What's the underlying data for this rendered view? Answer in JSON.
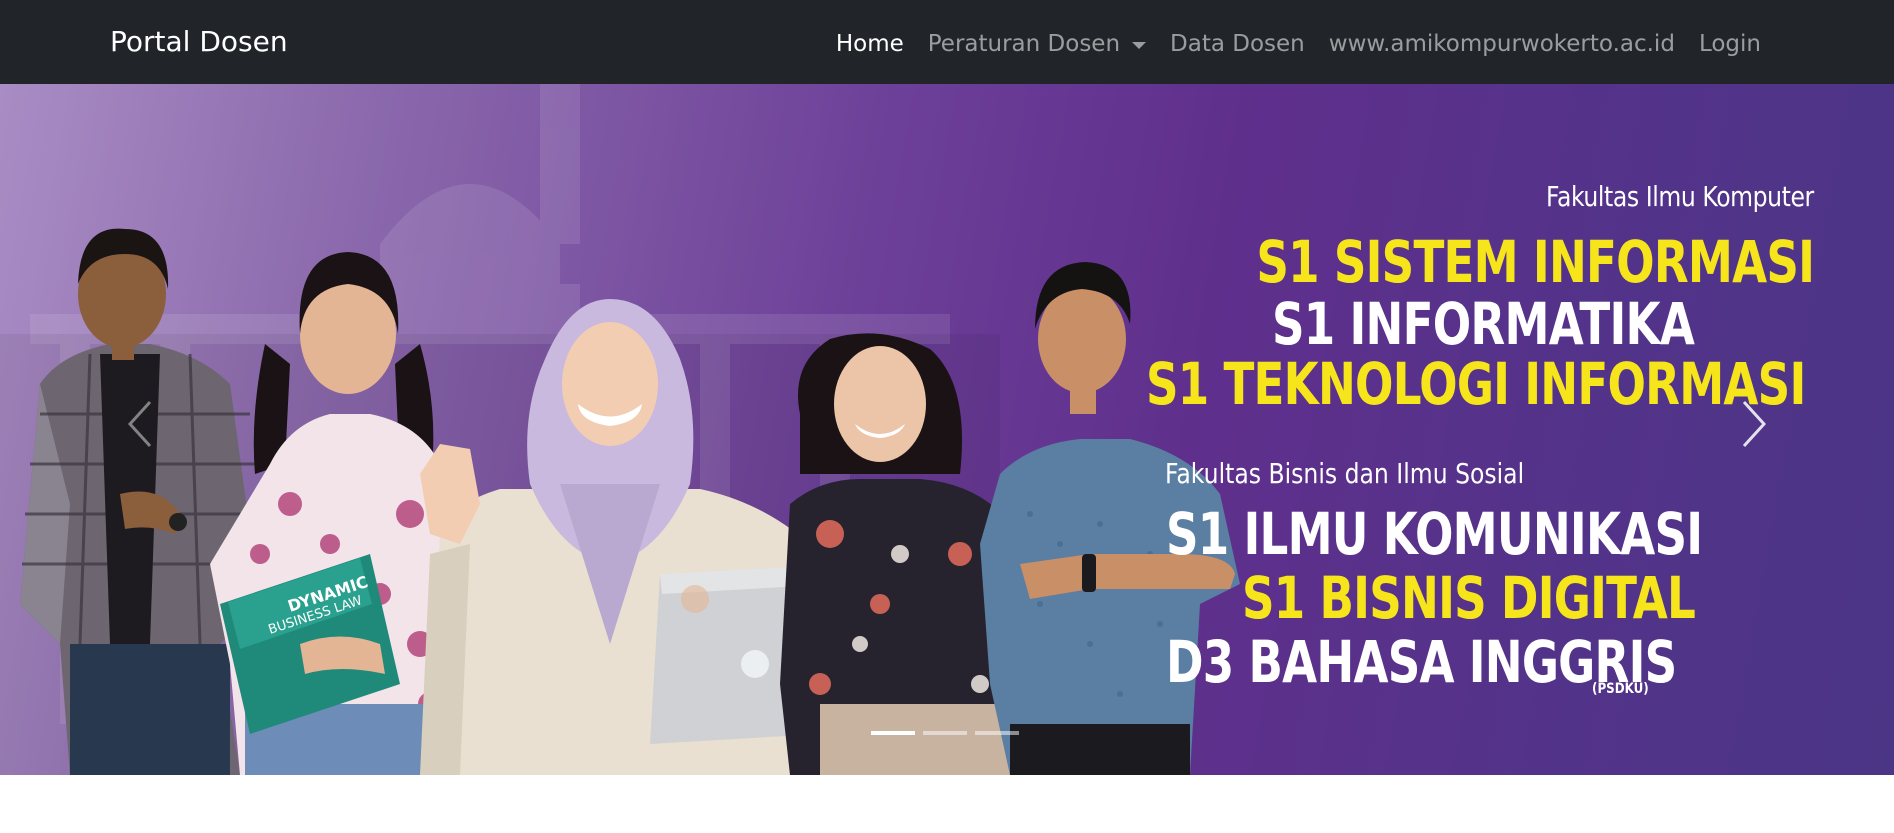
{
  "navbar": {
    "brand": "Portal Dosen",
    "links": [
      {
        "label": "Home",
        "active": true
      },
      {
        "label": "Peraturan Dosen",
        "dropdown": true
      },
      {
        "label": "Data Dosen"
      },
      {
        "label": "www.amikompurwokerto.ac.id"
      },
      {
        "label": "Login"
      }
    ]
  },
  "hero": {
    "faculty_1": "Fakultas Ilmu Komputer",
    "programs_1": [
      "S1 SISTEM INFORMASI",
      "S1 INFORMATIKA",
      "S1 TEKNOLOGI INFORMASI"
    ],
    "faculty_2": "Fakultas Bisnis dan Ilmu Sosial",
    "programs_2": [
      "S1 ILMU KOMUNIKASI",
      "S1 BISNIS DIGITAL",
      "D3 BAHASA INGGRIS"
    ],
    "psdku_tag": "(PSDKU)",
    "book_text_1": "DYNAMIC",
    "book_text_2": "BUSINESS LAW"
  },
  "carousel": {
    "slide_count": 3,
    "active_slide": 1
  },
  "colors": {
    "navbar_bg": "#212529",
    "accent_yellow": "#f7e51b",
    "hero_purple": "#5f2f8c"
  }
}
